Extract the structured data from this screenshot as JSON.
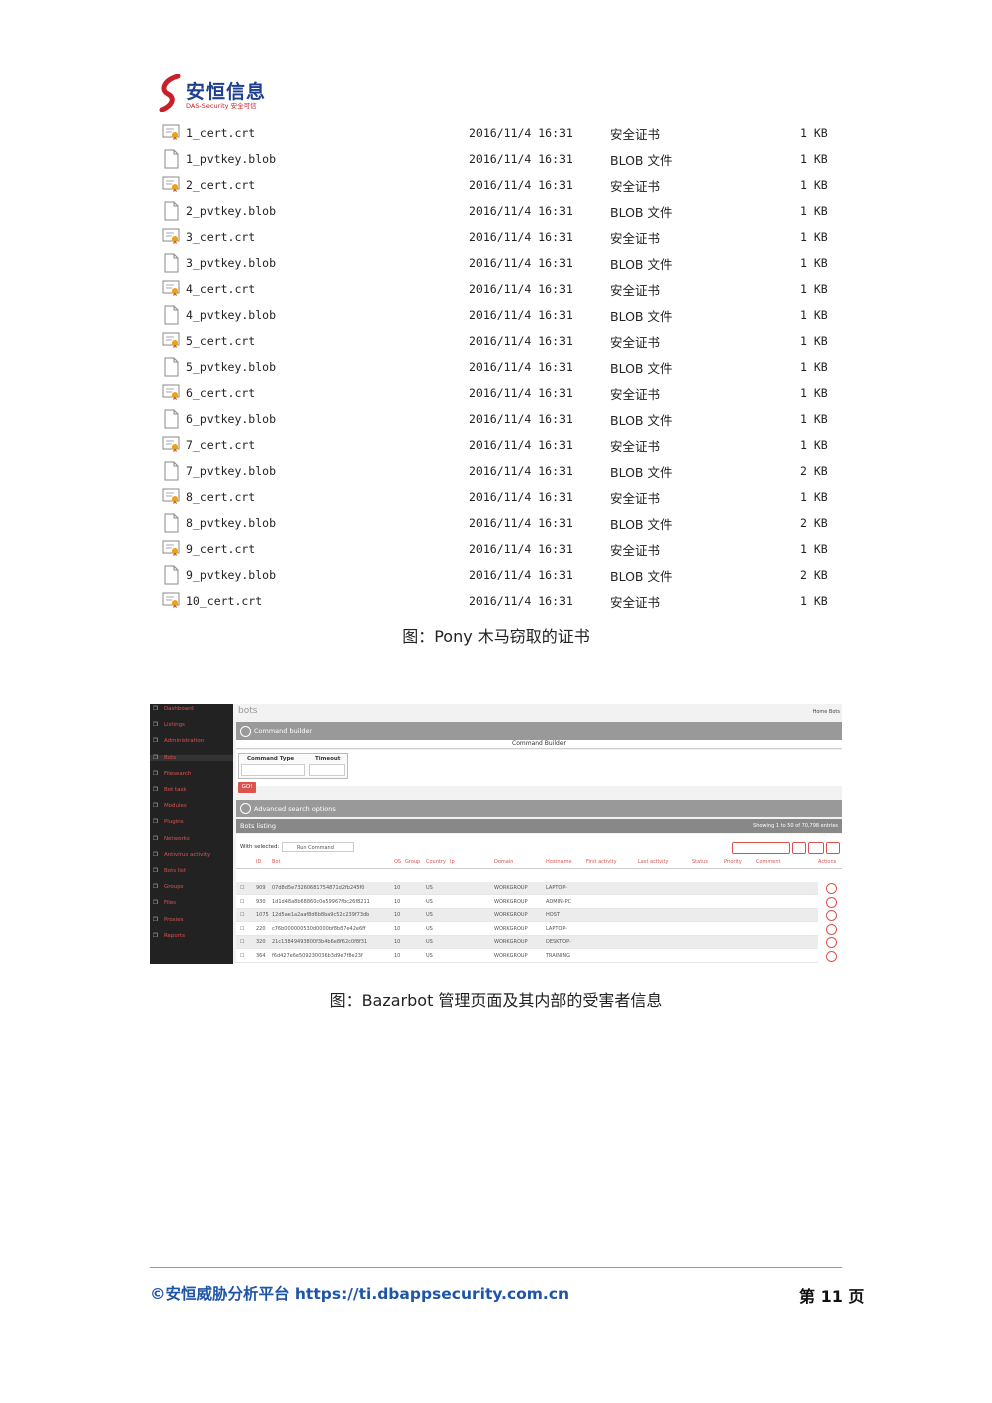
{
  "header": {
    "logo_text": "安恒信息",
    "logo_sub": "DAS-Security 安全可信"
  },
  "files": [
    {
      "name": "1_cert.crt",
      "date": "2016/11/4 16:31",
      "type": "安全证书",
      "size": "1 KB",
      "icon": "certificate-icon"
    },
    {
      "name": "1_pvtkey.blob",
      "date": "2016/11/4 16:31",
      "type": "BLOB 文件",
      "size": "1 KB",
      "icon": "blank-file-icon"
    },
    {
      "name": "2_cert.crt",
      "date": "2016/11/4 16:31",
      "type": "安全证书",
      "size": "1 KB",
      "icon": "certificate-icon"
    },
    {
      "name": "2_pvtkey.blob",
      "date": "2016/11/4 16:31",
      "type": "BLOB 文件",
      "size": "1 KB",
      "icon": "blank-file-icon"
    },
    {
      "name": "3_cert.crt",
      "date": "2016/11/4 16:31",
      "type": "安全证书",
      "size": "1 KB",
      "icon": "certificate-icon"
    },
    {
      "name": "3_pvtkey.blob",
      "date": "2016/11/4 16:31",
      "type": "BLOB 文件",
      "size": "1 KB",
      "icon": "blank-file-icon"
    },
    {
      "name": "4_cert.crt",
      "date": "2016/11/4 16:31",
      "type": "安全证书",
      "size": "1 KB",
      "icon": "certificate-icon"
    },
    {
      "name": "4_pvtkey.blob",
      "date": "2016/11/4 16:31",
      "type": "BLOB 文件",
      "size": "1 KB",
      "icon": "blank-file-icon"
    },
    {
      "name": "5_cert.crt",
      "date": "2016/11/4 16:31",
      "type": "安全证书",
      "size": "1 KB",
      "icon": "certificate-icon"
    },
    {
      "name": "5_pvtkey.blob",
      "date": "2016/11/4 16:31",
      "type": "BLOB 文件",
      "size": "1 KB",
      "icon": "blank-file-icon"
    },
    {
      "name": "6_cert.crt",
      "date": "2016/11/4 16:31",
      "type": "安全证书",
      "size": "1 KB",
      "icon": "certificate-icon"
    },
    {
      "name": "6_pvtkey.blob",
      "date": "2016/11/4 16:31",
      "type": "BLOB 文件",
      "size": "1 KB",
      "icon": "blank-file-icon"
    },
    {
      "name": "7_cert.crt",
      "date": "2016/11/4 16:31",
      "type": "安全证书",
      "size": "1 KB",
      "icon": "certificate-icon"
    },
    {
      "name": "7_pvtkey.blob",
      "date": "2016/11/4 16:31",
      "type": "BLOB 文件",
      "size": "2 KB",
      "icon": "blank-file-icon"
    },
    {
      "name": "8_cert.crt",
      "date": "2016/11/4 16:31",
      "type": "安全证书",
      "size": "1 KB",
      "icon": "certificate-icon"
    },
    {
      "name": "8_pvtkey.blob",
      "date": "2016/11/4 16:31",
      "type": "BLOB 文件",
      "size": "2 KB",
      "icon": "blank-file-icon"
    },
    {
      "name": "9_cert.crt",
      "date": "2016/11/4 16:31",
      "type": "安全证书",
      "size": "1 KB",
      "icon": "certificate-icon"
    },
    {
      "name": "9_pvtkey.blob",
      "date": "2016/11/4 16:31",
      "type": "BLOB 文件",
      "size": "2 KB",
      "icon": "blank-file-icon"
    },
    {
      "name": "10_cert.crt",
      "date": "2016/11/4 16:31",
      "type": "安全证书",
      "size": "1 KB",
      "icon": "certificate-icon"
    }
  ],
  "caption1": "图：Pony 木马窃取的证书",
  "bazarbot": {
    "sidebar": [
      "Dashboard",
      "Listings",
      "Administration",
      "Bots",
      "Filesearch",
      "Bot task",
      "Modules",
      "Plugins",
      "Networks",
      "Antivirus activity",
      "Bots list",
      "Groups",
      "Files",
      "Proxies",
      "Reports"
    ],
    "active_index": 3,
    "title": "bots",
    "header_right": "Home  Bots",
    "command_builder": "Command builder",
    "command_builder_title": "Command Builder",
    "command_type_label": "Command Type",
    "timeout_label": "Timeout",
    "go_label": "GO!",
    "advanced_search": "Advanced search options",
    "bots_listing": "Bots listing",
    "showing": "Showing 1 to 50 of 70,798 entries",
    "with_selected": "With selected:",
    "run_command": "Run Command",
    "columns": [
      "ID",
      "Bot",
      "OS",
      "Group",
      "Country",
      "Ip",
      "Domain",
      "Hostname",
      "First activity",
      "Last activity",
      "Status",
      "Priority",
      "Comment",
      "Actions"
    ],
    "rows": [
      {
        "id": "909",
        "bot": "07d8d5e73260681754871d2fb245f0",
        "os": "10",
        "group": "US",
        "domain": "WORKGROUP",
        "host": "LAPTOP-"
      },
      {
        "id": "930",
        "bot": "1d1d48a8b68860c0e59967fbc26f8211",
        "os": "10",
        "group": "US",
        "domain": "WORKGROUP",
        "host": "ADMIN-PC"
      },
      {
        "id": "1075",
        "bot": "12d5ae1a2aaf8d6b8ba9c52c239f73db",
        "os": "10",
        "group": "US",
        "domain": "WORKGROUP",
        "host": "HOST"
      },
      {
        "id": "220",
        "bot": "c76b000000530d0000bf8b87e42e6ff",
        "os": "10",
        "group": "US",
        "domain": "WORKGROUP",
        "host": "LAPTOP-"
      },
      {
        "id": "320",
        "bot": "21c13849493800f3b4b6e8f62c0f8f31",
        "os": "10",
        "group": "US",
        "domain": "WORKGROUP",
        "host": "DESKTOP-"
      },
      {
        "id": "364",
        "bot": "f6d427e6e509230036b3d9e7f8e23f",
        "os": "10",
        "group": "US",
        "domain": "WORKGROUP",
        "host": "TRAINING"
      }
    ]
  },
  "caption2": "图：Bazarbot 管理页面及其内部的受害者信息",
  "footer": {
    "left": "©安恒威胁分析平台 https://ti.dbappsecurity.com.cn",
    "right": "第 11 页"
  }
}
